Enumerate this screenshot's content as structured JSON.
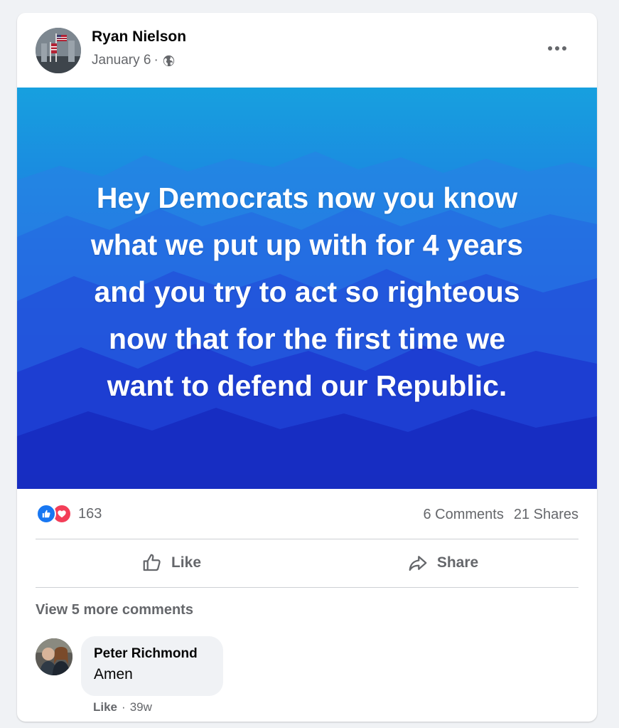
{
  "post": {
    "author": "Ryan Nielson",
    "date": "January 6",
    "date_separator": "·",
    "privacy_icon": "globe-icon",
    "more_icon": "ellipsis-icon",
    "image_text_lines": [
      "Hey Democrats now you know",
      "what we put up with for 4 years",
      "and you try to act so righteous",
      "now that for the first time we",
      "want to defend our Republic."
    ]
  },
  "stats": {
    "reaction_icons": [
      "like-reaction-icon",
      "love-reaction-icon"
    ],
    "reaction_count": "163",
    "comments": "6 Comments",
    "shares": "21 Shares"
  },
  "actions": {
    "like_label": "Like",
    "share_label": "Share"
  },
  "comments": {
    "view_more": "View 5 more comments",
    "items": [
      {
        "name": "Peter Richmond",
        "text": "Amen",
        "like_label": "Like",
        "separator": "·",
        "time": "39w"
      }
    ]
  },
  "colors": {
    "banner_top": "#1aa3e0",
    "banner_bottom": "#1a2fd6",
    "like_blue": "#1877f2",
    "love_red": "#f33e58",
    "secondary_text": "#65676b"
  }
}
